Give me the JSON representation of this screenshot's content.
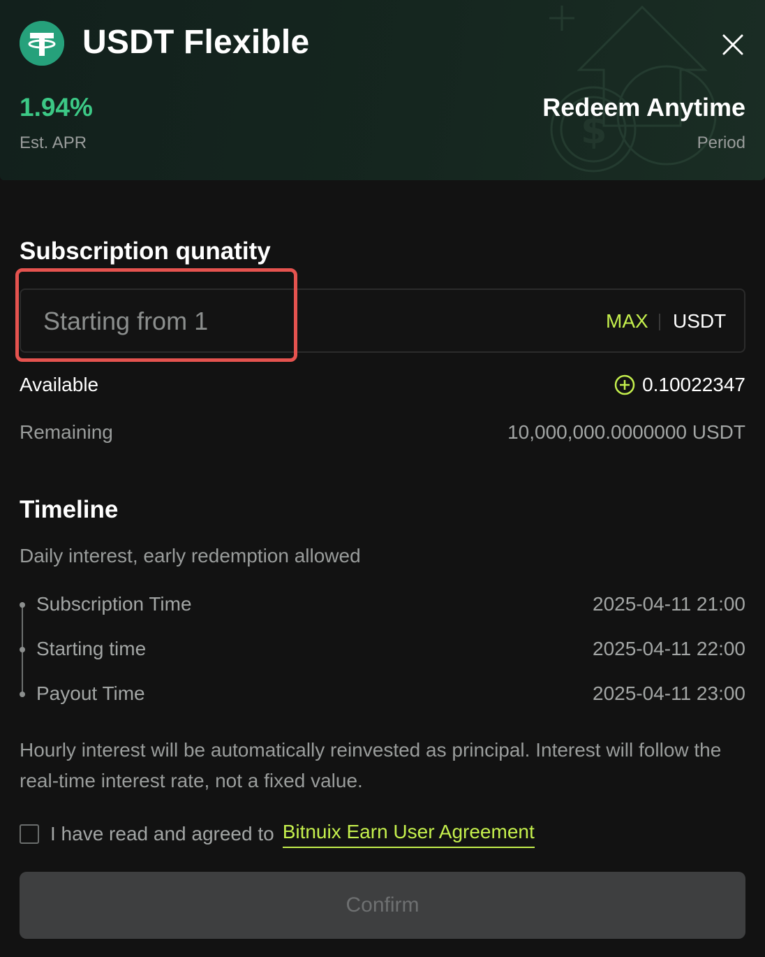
{
  "header": {
    "title": "USDT Flexible",
    "apr_value": "1.94%",
    "apr_label": "Est. APR",
    "period_value": "Redeem Anytime",
    "period_label": "Period"
  },
  "subscription": {
    "title": "Subscription qunatity",
    "input_placeholder": "Starting from 1",
    "max_label": "MAX",
    "unit": "USDT",
    "available_label": "Available",
    "available_value": "0.10022347",
    "remaining_label": "Remaining",
    "remaining_value": "10,000,000.0000000 USDT"
  },
  "timeline": {
    "title": "Timeline",
    "description": "Daily interest, early redemption allowed",
    "items": [
      {
        "label": "Subscription Time",
        "value": "2025-04-11 21:00"
      },
      {
        "label": "Starting time",
        "value": "2025-04-11 22:00"
      },
      {
        "label": "Payout Time",
        "value": "2025-04-11 23:00"
      }
    ]
  },
  "note": "Hourly interest will be automatically reinvested as principal. Interest will follow the real-time interest rate, not a fixed value.",
  "agreement": {
    "text": "I have read and agreed to",
    "link": "Bitnuix Earn User Agreement",
    "checked": false
  },
  "confirm_label": "Confirm",
  "colors": {
    "accent_green": "#3cc986",
    "accent_lime": "#c5f04d",
    "tether_green": "#26a17b",
    "highlight_red": "#e5534f"
  }
}
